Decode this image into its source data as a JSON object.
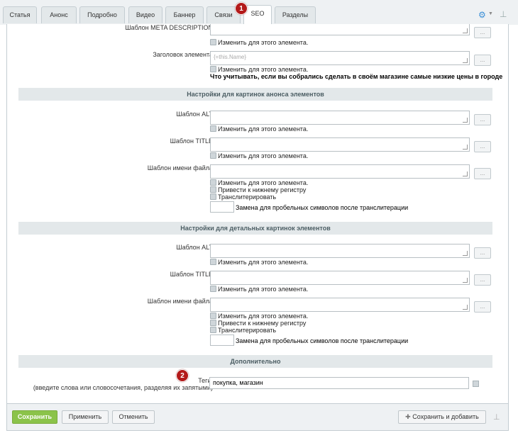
{
  "tabs": [
    {
      "label": "Статья"
    },
    {
      "label": "Анонс"
    },
    {
      "label": "Подробно"
    },
    {
      "label": "Видео"
    },
    {
      "label": "Баннер"
    },
    {
      "label": "Связи"
    },
    {
      "label": "SEO"
    },
    {
      "label": "Разделы"
    }
  ],
  "badges": {
    "one": "1",
    "two": "2"
  },
  "seo": {
    "meta_description_label": "Шаблон META DESCRIPTION",
    "element_title_label": "Заголовок элемента",
    "element_title_value": "{=this.Name}",
    "change_label": "Изменить для этого элемента.",
    "preview_note": "Что учитывать, если вы собрались сделать в своём магазине самые низкие цены в городе"
  },
  "anons_images": {
    "section_title": "Настройки для картинок анонса элементов",
    "alt_label": "Шаблон ALT",
    "title_label": "Шаблон TITLE",
    "filename_label": "Шаблон имени файла",
    "change_label": "Изменить для этого элемента.",
    "lowercase_label": "Привести к нижнему регистру",
    "translit_label": "Транслитерировать",
    "space_replace_label": "Замена для пробельных символов после транслитерации"
  },
  "detail_images": {
    "section_title": "Настройки для детальных картинок элементов",
    "alt_label": "Шаблон ALT",
    "title_label": "Шаблон TITLE",
    "filename_label": "Шаблон имени файла",
    "change_label": "Изменить для этого элемента.",
    "lowercase_label": "Привести к нижнему регистру",
    "translit_label": "Транслитерировать",
    "space_replace_label": "Замена для пробельных символов после транслитерации"
  },
  "extra": {
    "section_title": "Дополнительно",
    "tags_label": "Теги:",
    "tags_hint": "(введите слова или словосочетания, разделяя их запятыми)",
    "tags_value": "покупка, магазин"
  },
  "dots": "...",
  "footer": {
    "save": "Сохранить",
    "apply": "Применить",
    "cancel": "Отменить",
    "save_add": "Сохранить и добавить"
  },
  "colors": {
    "primary": "#8bc34a",
    "badge": "#b31a1a",
    "accent": "#3a8fd6"
  }
}
